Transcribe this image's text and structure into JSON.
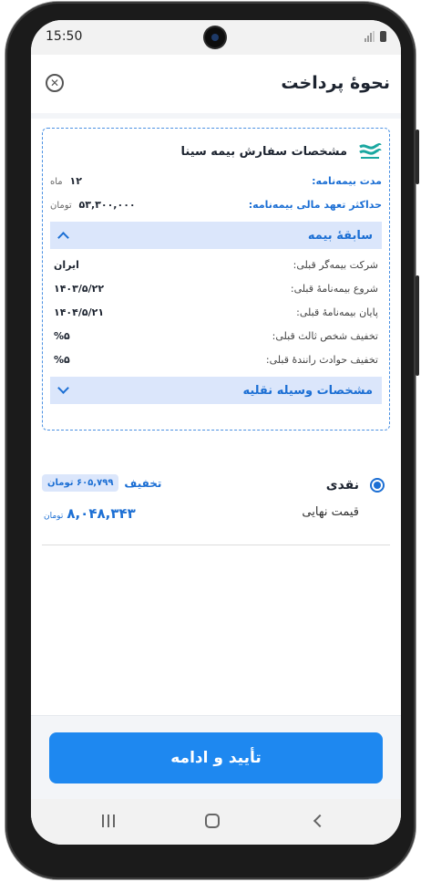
{
  "status_bar": {
    "time": "15:50"
  },
  "header": {
    "title": "نحوهٔ پرداخت"
  },
  "order": {
    "title": "مشخصات سفارش بیمه سینا",
    "policy_duration_label": "مدت بیمه‌نامه:",
    "policy_duration_value": "۱۲",
    "policy_duration_unit": "ماه",
    "max_liability_label": "حداکثر تعهد مالی بیمه‌نامه:",
    "max_liability_value": "۵۳,۳۰۰,۰۰۰",
    "max_liability_unit": "تومان"
  },
  "history": {
    "section_title": "سابقهٔ بیمه",
    "rows": [
      {
        "label": "شرکت بیمه‌گر قبلی:",
        "value": "ایران"
      },
      {
        "label": "شروع بیمه‌نامهٔ قبلی:",
        "value": "۱۴۰۳/۵/۲۲"
      },
      {
        "label": "پایان بیمه‌نامهٔ قبلی:",
        "value": "۱۴۰۴/۵/۲۱"
      },
      {
        "label": "تخفیف شخص ثالث قبلی:",
        "value": "%۵"
      },
      {
        "label": "تخفیف حوادث رانندهٔ قبلی:",
        "value": "%۵"
      }
    ]
  },
  "vehicle": {
    "section_title": "مشخصات وسیله نقلیه"
  },
  "payment": {
    "option_label": "نقدی",
    "discount_label": "تخفیف",
    "discount_value": "۶۰۵,۷۹۹ تومان",
    "final_price_label": "قیمت نهایی",
    "final_price_value": "۸,۰۴۸,۳۴۳",
    "final_price_unit": "تومان"
  },
  "footer": {
    "confirm_label": "تأیید و ادامه"
  },
  "colors": {
    "accent": "#1e88f0",
    "link_blue": "#1c6fd4",
    "section_bg": "#dbe6fb"
  }
}
